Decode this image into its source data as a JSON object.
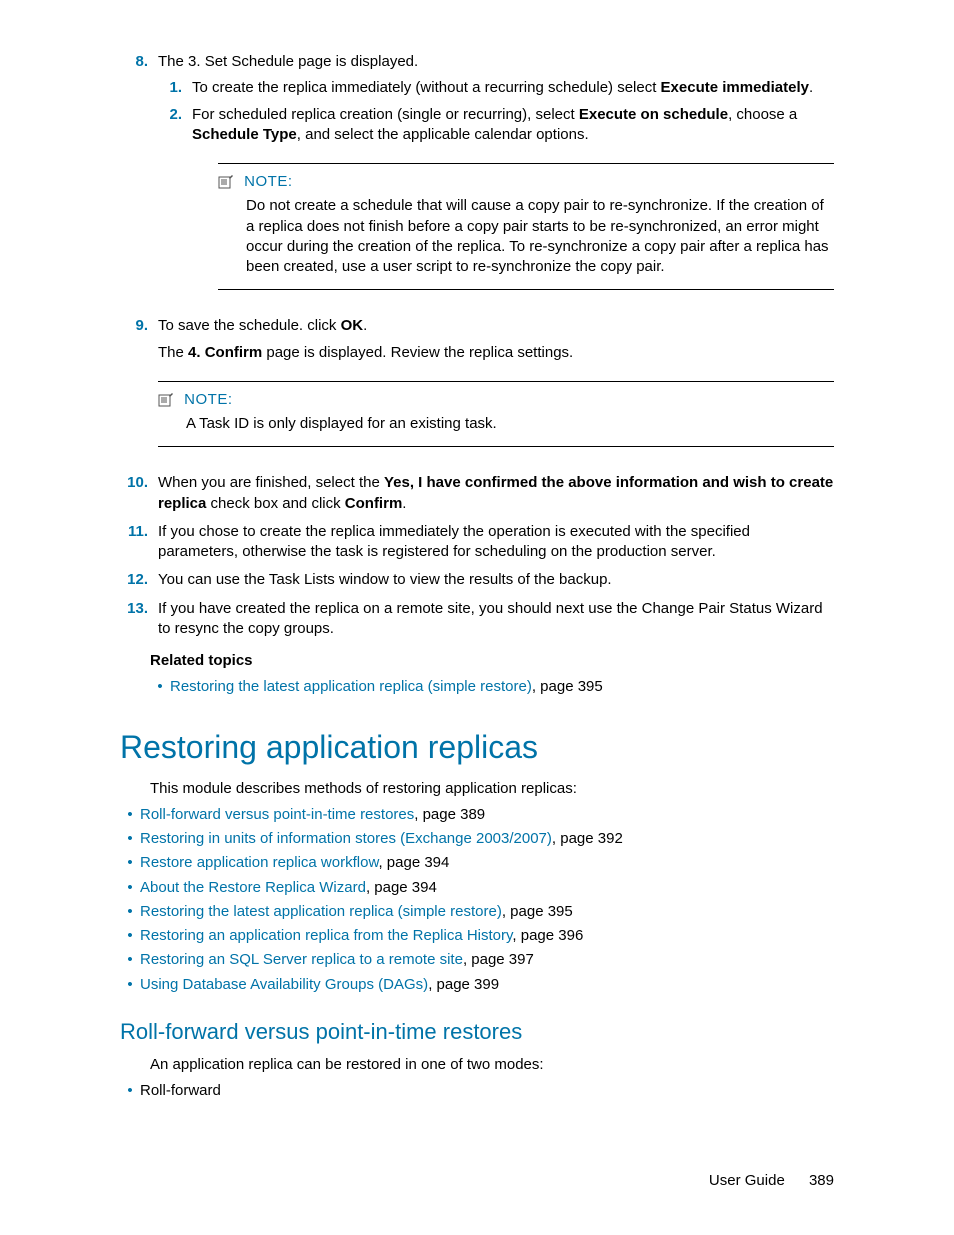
{
  "steps": {
    "s8": {
      "num": "8.",
      "text": "The 3. Set Schedule page is displayed.",
      "sub1_num": "1.",
      "sub1_a": "To create the replica immediately (without a recurring schedule) select ",
      "sub1_b": "Execute immediately",
      "sub1_c": ".",
      "sub2_num": "2.",
      "sub2_a": "For scheduled replica creation (single or recurring), select ",
      "sub2_b": "Execute on schedule",
      "sub2_c": ", choose a ",
      "sub2_d": "Schedule Type",
      "sub2_e": ", and select the applicable calendar options."
    },
    "note1": {
      "title": "NOTE:",
      "body": "Do not create a schedule that will cause a copy pair to re-synchronize. If the creation of a replica does not finish before a copy pair starts to be re-synchronized, an error might occur during the creation of the replica. To re-synchronize a copy pair after a replica has been created, use a user script to re-synchronize the copy pair."
    },
    "s9": {
      "num": "9.",
      "a": "To save the schedule. click ",
      "b": "OK",
      "c": ".",
      "line2a": "The ",
      "line2b": "4. Confirm",
      "line2c": " page is displayed. Review the replica settings."
    },
    "note2": {
      "title": "NOTE:",
      "body": "A Task ID is only displayed for an existing task."
    },
    "s10": {
      "num": "10.",
      "a": "When you are finished, select the ",
      "b": "Yes, I have confirmed the above information and wish to create replica",
      "c": " check box and click ",
      "d": "Confirm",
      "e": "."
    },
    "s11": {
      "num": "11.",
      "text": "If you chose to create the replica immediately the operation is executed with the specified parameters, otherwise the task is registered for scheduling on the production server."
    },
    "s12": {
      "num": "12.",
      "text": "You can use the Task Lists window to view the results of the backup."
    },
    "s13": {
      "num": "13.",
      "text": "If you have created the replica on a remote site, you should next use the Change Pair Status Wizard to resync the copy groups."
    }
  },
  "related": {
    "title": "Related topics",
    "item1_link": "Restoring the latest application replica (simple restore)",
    "item1_tail": ", page 395"
  },
  "h1": "Restoring application replicas",
  "h1_intro": "This module describes methods of restoring application replicas:",
  "toc": {
    "i1_link": "Roll-forward versus point-in-time restores",
    "i1_tail": ", page 389",
    "i2_link": "Restoring in units of information stores (Exchange 2003/2007)",
    "i2_tail": ", page 392",
    "i3_link": "Restore application replica workflow",
    "i3_tail": ", page 394",
    "i4_link": "About the Restore Replica Wizard",
    "i4_tail": ", page 394",
    "i5_link": "Restoring the latest application replica (simple restore)",
    "i5_tail": ", page 395",
    "i6_link": "Restoring an application replica from the Replica History",
    "i6_tail": ", page 396",
    "i7_link": "Restoring an SQL Server replica to a remote site",
    "i7_tail": ", page 397",
    "i8_link": "Using Database Availability Groups (DAGs)",
    "i8_tail": ", page 399"
  },
  "h2": "Roll-forward versus point-in-time restores",
  "h2_intro": "An application replica can be restored in one of two modes:",
  "modes": {
    "m1": "Roll-forward"
  },
  "footer": {
    "label": "User Guide",
    "page": "389"
  },
  "bullet": "•"
}
